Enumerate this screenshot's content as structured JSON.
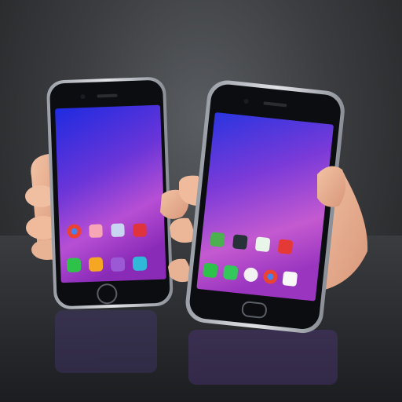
{
  "scene": {
    "background_color": "#3b3d40",
    "surface_color": "#2a2b2e",
    "wallpaper_top": "#2a2fd8",
    "wallpaper_mid": "#7a2fd0",
    "wallpaper_bottom": "#c45ad0"
  },
  "left_phone": {
    "apps_row1": [
      "chrome-icon",
      "gallery-icon",
      "settings-icon",
      "video-icon"
    ],
    "apps_row2": [
      "phone-icon",
      "contacts-icon",
      "messages-icon",
      "camera-icon"
    ]
  },
  "right_phone": {
    "apps_row1": [
      "maps-icon",
      "play-icon",
      "photos-icon",
      "store-icon"
    ],
    "apps_row2": [
      "phone-icon",
      "messages-icon",
      "contacts-icon",
      "chrome-icon",
      "gallery-icon"
    ]
  }
}
